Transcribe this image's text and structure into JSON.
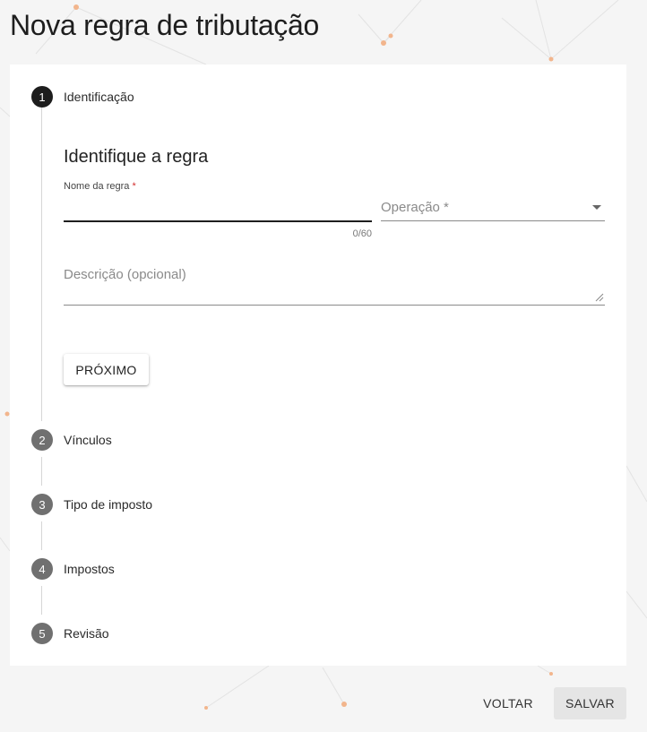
{
  "page": {
    "title": "Nova regra de tributação"
  },
  "stepper": {
    "steps": [
      {
        "number": "1",
        "label": "Identificação"
      },
      {
        "number": "2",
        "label": "Vínculos"
      },
      {
        "number": "3",
        "label": "Tipo de imposto"
      },
      {
        "number": "4",
        "label": "Impostos"
      },
      {
        "number": "5",
        "label": "Revisão"
      }
    ],
    "active_step": 1
  },
  "form": {
    "section_title": "Identifique a regra",
    "name": {
      "label": "Nome da regra",
      "required_mark": "*",
      "value": "",
      "counter": "0/60"
    },
    "operation": {
      "label": "Operação *",
      "value": ""
    },
    "description": {
      "label": "Descrição (opcional)",
      "value": ""
    },
    "next_label": "PRÓXIMO"
  },
  "footer": {
    "back_label": "VOLTAR",
    "save_label": "SALVAR"
  },
  "colors": {
    "background": "#f5f5f5",
    "active_step": "#1d1d1d",
    "inactive_step": "#707070",
    "required": "#d32f2f",
    "decor": "#f2b58c"
  }
}
